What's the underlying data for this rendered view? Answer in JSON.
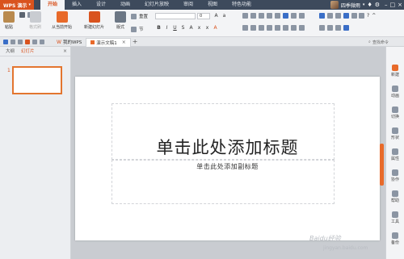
{
  "app": {
    "name": "WPS 演示"
  },
  "menu": {
    "tabs": [
      "开始",
      "插入",
      "设计",
      "动画",
      "幻灯片放映",
      "审阅",
      "视图",
      "特色功能"
    ],
    "active_index": 0
  },
  "user": {
    "name": "四季微雨"
  },
  "ribbon": {
    "paste_label": "粘贴",
    "format_painter_label": "格式刷",
    "from_current_label": "从当前开始",
    "new_slide_label": "新建幻灯片",
    "layout_label": "版式",
    "section_label": "节",
    "reset_label": "重置",
    "font_size_value": "0"
  },
  "tabs": {
    "items": [
      {
        "label": "我的WPS",
        "active": false
      },
      {
        "label": "演示文稿1",
        "active": true
      }
    ],
    "new_tab": "+",
    "command_search": "查找命令"
  },
  "left_pane": {
    "tabs": [
      "大纲",
      "幻灯片"
    ],
    "active_index": 1,
    "slide_number": "1"
  },
  "slide": {
    "title_placeholder": "单击此处添加标题",
    "subtitle_placeholder": "单击此处添加副标题"
  },
  "right_bar": {
    "items": [
      "新建",
      "动画",
      "切换",
      "形状",
      "属性",
      "协作",
      "帮助",
      "工具",
      "备份"
    ]
  },
  "watermark": {
    "text": "Baidu经验",
    "url": "jingyan.baidu.com"
  },
  "colors": {
    "accent": "#d9531e",
    "menubar": "#3d4a5c"
  }
}
